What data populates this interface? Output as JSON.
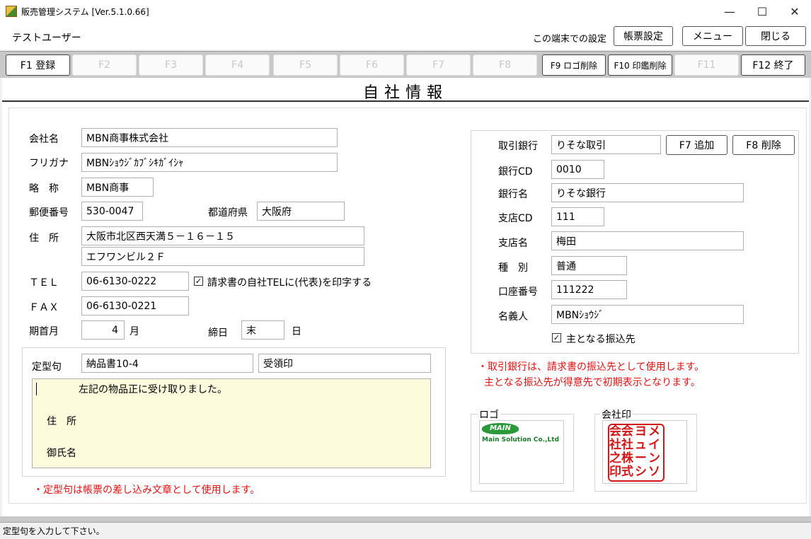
{
  "window": {
    "title": "販売管理システム [Ver.5.1.0.66]",
    "minimize_glyph": "—",
    "maximize_glyph": "☐",
    "close_glyph": "✕"
  },
  "header": {
    "user": "テストユーザー",
    "local_settings_label": "この端末での設定",
    "report_settings": "帳票設定",
    "menu": "メニュー",
    "close": "閉じる"
  },
  "fkeys": [
    {
      "label": "F1 登録",
      "enabled": true
    },
    {
      "label": "F2",
      "enabled": false
    },
    {
      "label": "F3",
      "enabled": false
    },
    {
      "label": "F4",
      "enabled": false
    },
    {
      "label": "F5",
      "enabled": false
    },
    {
      "label": "F6",
      "enabled": false
    },
    {
      "label": "F7",
      "enabled": false
    },
    {
      "label": "F8",
      "enabled": false
    },
    {
      "label": "F9 ロゴ削除",
      "enabled": true
    },
    {
      "label": "F10 印鑑削除",
      "enabled": true
    },
    {
      "label": "F11",
      "enabled": false
    },
    {
      "label": "F12 終了",
      "enabled": true
    }
  ],
  "page_title": "自社情報",
  "company": {
    "name_label": "会社名",
    "name": "MBN商事株式会社",
    "kana_label": "フリガナ",
    "kana": "MBNｼｮｳｼﾞｶﾌﾞｼｷｶﾞｲｼｬ",
    "short_label": "略　称",
    "short": "MBN商事",
    "zip_label": "郵便番号",
    "zip": "530-0047",
    "pref_label": "都道府県",
    "pref": "大阪府",
    "address_label": "住　所",
    "address1": "大阪市北区西天満５－１６－１５",
    "address2": "エフワンビル２Ｆ",
    "tel_label": "ＴＥＬ",
    "tel": "06-6130-0222",
    "tel_print_checked": true,
    "tel_print_label": "請求書の自社TELに(代表)を印字する",
    "fax_label": "ＦＡＸ",
    "fax": "06-6130-0221",
    "fiscal_label": "期首月",
    "fiscal_month": "4",
    "month_unit": "月",
    "closing_label": "締日",
    "closing_day": "末",
    "day_unit": "日"
  },
  "phrase": {
    "label": "定型句",
    "select": "納品書10-4",
    "stamp": "受領印",
    "line1": "左記の物品正に受け取りました。",
    "line2": "住　所",
    "line3": "御氏名",
    "note": "・定型句は帳票の差し込み文章として使用します。"
  },
  "bank": {
    "bank_label": "取引銀行",
    "bank": "りそな取引",
    "add_button": "F7 追加",
    "delete_button": "F8 削除",
    "bank_cd_label": "銀行CD",
    "bank_cd": "0010",
    "bank_name_label": "銀行名",
    "bank_name": "りそな銀行",
    "branch_cd_label": "支店CD",
    "branch_cd": "111",
    "branch_name_label": "支店名",
    "branch_name": "梅田",
    "type_label": "種　別",
    "type": "普通",
    "account_label": "口座番号",
    "account": "111222",
    "holder_label": "名義人",
    "holder": "MBNｼｮｳｼﾞ",
    "main_checked": true,
    "main_label": "主となる振込先",
    "note1": "・取引銀行は、請求書の振込先として使用します。",
    "note2": "主となる振込先が得意先で初期表示となります。"
  },
  "logo": {
    "label": "ロゴ",
    "mark": "MAIN",
    "text": "Main Solution Co.,Ltd"
  },
  "seal": {
    "label": "会社印",
    "chars": [
      "メ",
      "ヨ",
      "会",
      "イ",
      "ュ",
      "社",
      "ン",
      "ー",
      "株",
      "ソ",
      "シ",
      "式",
      "印",
      "之"
    ]
  },
  "status": "定型句を入力して下さい。"
}
